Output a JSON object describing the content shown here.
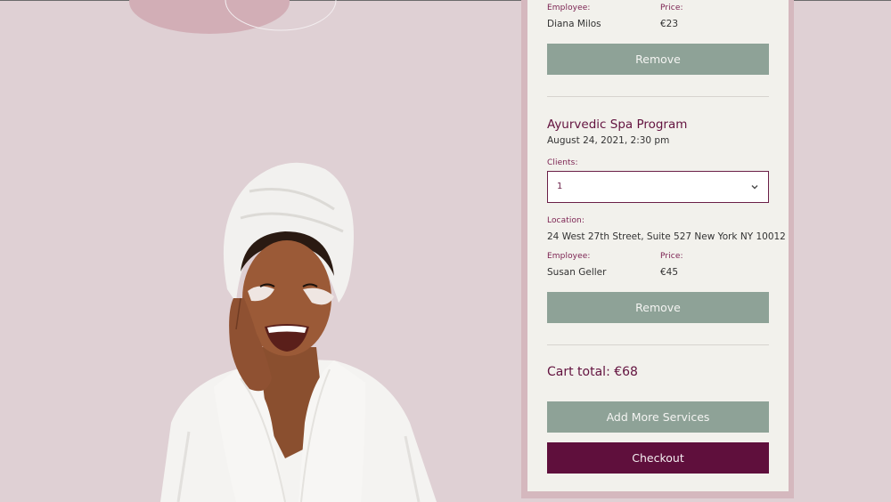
{
  "cart": {
    "item1": {
      "employee_label": "Employee:",
      "employee": "Diana Milos",
      "price_label": "Price:",
      "price": "€23",
      "remove_label": "Remove"
    },
    "item2": {
      "title": "Ayurvedic Spa Program",
      "datetime": "August 24, 2021, 2:30 pm",
      "clients_label": "Clients:",
      "clients_value": "1",
      "location_label": "Location:",
      "location": "24 West 27th Street, Suite 527 New York NY 10012",
      "employee_label": "Employee:",
      "employee": "Susan Geller",
      "price_label": "Price:",
      "price": "€45",
      "remove_label": "Remove"
    },
    "total_label": "Cart total: €68",
    "add_more_label": "Add More Services",
    "checkout_label": "Checkout"
  },
  "icons": {
    "select_arrow": "chevron-down-icon"
  },
  "colors": {
    "background": "#dfd0d4",
    "accent": "#63133f",
    "button_green": "#8ea297",
    "checkout": "#5f0f3c",
    "panel": "#f2f1ec"
  }
}
